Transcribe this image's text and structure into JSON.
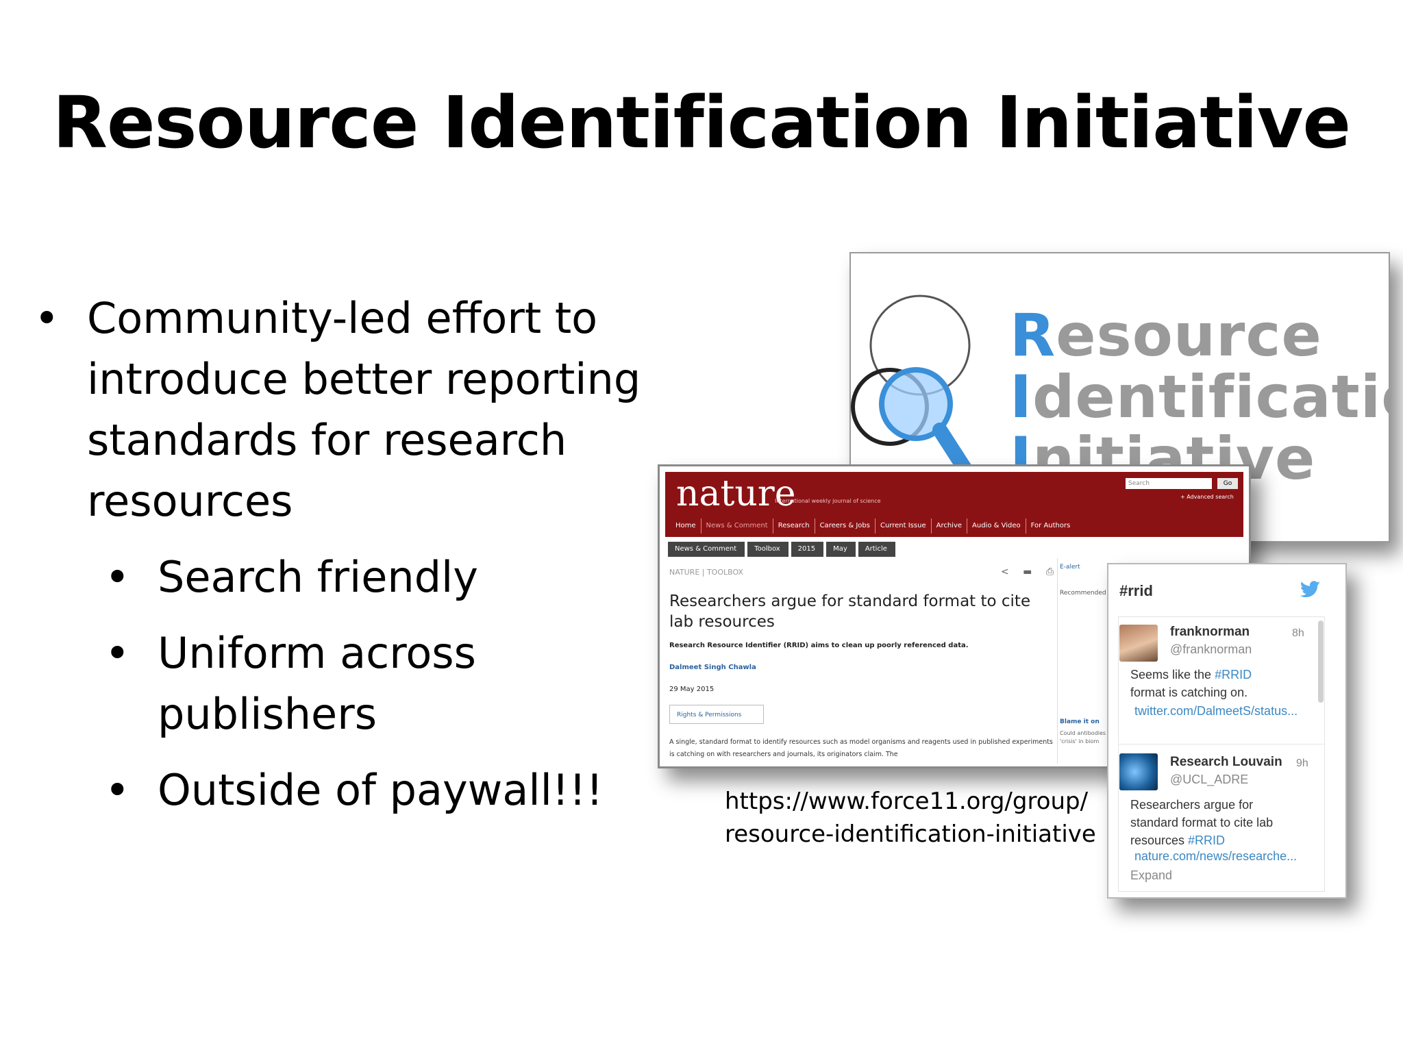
{
  "title": "Resource Identification Initiative",
  "bullets": {
    "main": "Community-led effort to introduce better reporting standards for research resources",
    "sub": [
      "Search friendly",
      "Uniform across publishers",
      "Outside of paywall!!!"
    ],
    "marker": "•"
  },
  "logo_card": {
    "word1_cap": "R",
    "word1_rest": "esource",
    "word2_cap": "I",
    "word2_rest": "dentification",
    "word3_cap": "I",
    "word3_rest": "nitiative",
    "accent_color": "#3a8fd8",
    "text_color": "#9a9a9a"
  },
  "nature_card": {
    "logo": "nature",
    "tagline": "International weekly journal of science",
    "search_placeholder": "Search",
    "go_label": "Go",
    "advanced_search": "+ Advanced search",
    "nav": [
      "Home",
      "News & Comment",
      "Research",
      "Careers & Jobs",
      "Current Issue",
      "Archive",
      "Audio & Video",
      "For Authors"
    ],
    "breadcrumbs": [
      "News & Comment",
      "Toolbox",
      "2015",
      "May",
      "Article"
    ],
    "section": "NATURE | TOOLBOX",
    "icons": "< ▬ ⎙",
    "headline": "Researchers argue for standard format to cite lab resources",
    "standfirst": "Research Resource Identifier (RRID) aims to clean up poorly referenced data.",
    "author": "Dalmeet Singh Chawla",
    "date": "29 May 2015",
    "rights_label": "Rights & Permissions",
    "body": "A single, standard format to identify resources such as model organisms and reagents used in published experiments is catching on with researchers and journals, its originators claim. The",
    "email_label": "E-alert",
    "recommended_label": "Recommended",
    "sidebar_link": "Blame it on",
    "sidebar_text": "Could antibodies 'crisis' in biom",
    "brand_color": "#8b1214"
  },
  "twitter_card": {
    "hashtag": "#rrid",
    "tweets": [
      {
        "name": "franknorman",
        "handle": "@franknorman",
        "time": "8h",
        "text_a": "Seems like the ",
        "hashtag": "#RRID",
        "text_b": "format is catching on.",
        "link": "twitter.com/DalmeetS/status..."
      },
      {
        "name": "Research Louvain",
        "handle": "@UCL_ADRE",
        "time": "9h",
        "text_a": "Researchers argue for standard format to cite lab resources ",
        "hashtag": "#RRID",
        "link": "nature.com/news/researche...",
        "expand": "Expand"
      }
    ],
    "link_color": "#3b88c3",
    "bird_color": "#55acee"
  },
  "url": {
    "line1": "https://www.force11.org/group/",
    "line2": "resource-identification-initiative"
  }
}
